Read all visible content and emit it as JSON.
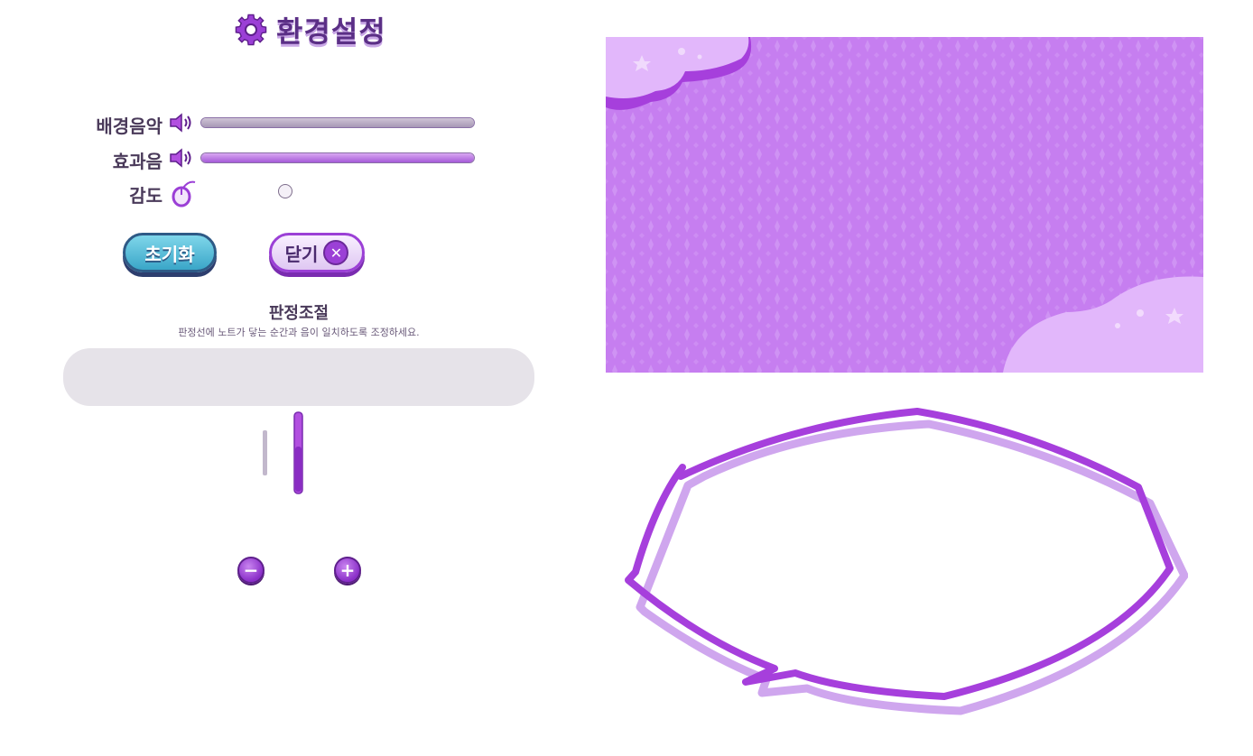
{
  "title": "환경설정",
  "settings": {
    "bgm_label": "배경음악",
    "bgm_level": 1.0,
    "sfx_label": "효과음",
    "sfx_level": 1.0,
    "sensitivity_label": "감도",
    "sensitivity_level": 0.3
  },
  "buttons": {
    "reset_label": "초기화",
    "close_label": "닫기"
  },
  "judgement": {
    "title": "판정조절",
    "description": "판정선에 노트가 닿는 순간과 음이 일치하도록 조정하세요."
  },
  "icons": {
    "gear": "gear-icon",
    "speaker": "speaker-icon",
    "mouse": "mouse-icon",
    "close": "close-icon",
    "minus": "minus-icon",
    "plus": "plus-icon"
  },
  "colors": {
    "accent_purple": "#a64fe0",
    "teal_button": "#4bb4d4",
    "panel_background": "#c67ef0",
    "cloud": "#e2b7fb"
  }
}
